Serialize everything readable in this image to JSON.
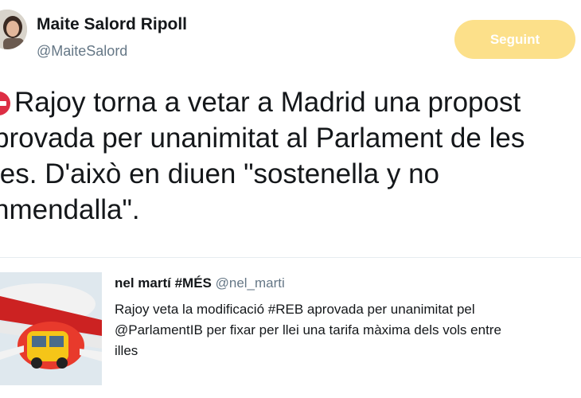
{
  "author": {
    "name": "Maite Salord Ripoll",
    "handle": "@MaiteSalord"
  },
  "follow_button": {
    "label": "Seguint",
    "color": "#fce08a"
  },
  "tweet": {
    "icon": "no-entry-icon",
    "lines": [
      "Rajoy torna a vetar a Madrid una propost",
      "provada per unanimitat al Parlament de les",
      "les. D'això en diuen \"sostenella y no",
      "nmendalla\"."
    ]
  },
  "quoted_tweet": {
    "author_name": "nel martí #MÉS",
    "author_handle": "@nel_marti",
    "lines": [
      "Rajoy veta la modificació #REB aprovada per unanimitat pel",
      "@ParlamentIB per fixar per llei una tarifa màxima dels vols entre",
      "illes"
    ]
  },
  "colors": {
    "text_primary": "#14171a",
    "text_secondary": "#657786",
    "divider": "#e6ecf0"
  }
}
